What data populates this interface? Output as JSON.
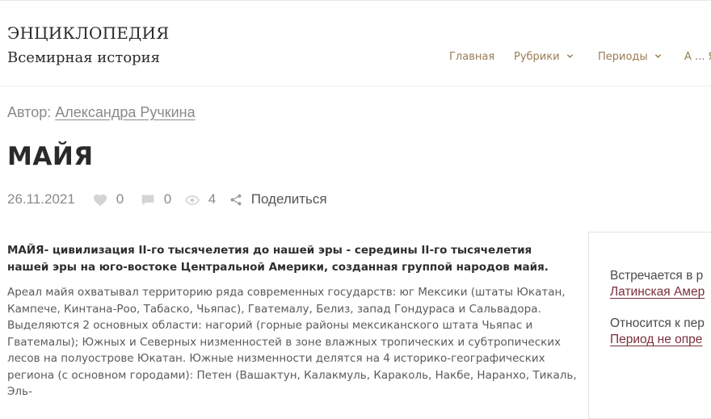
{
  "header": {
    "site_name": "ЭНЦИКЛОПЕДИЯ",
    "site_description": "Всемирная история",
    "nav": [
      {
        "label": "Главная",
        "has_dropdown": false
      },
      {
        "label": "Рубрики",
        "has_dropdown": true
      },
      {
        "label": "Периоды",
        "has_dropdown": true
      },
      {
        "label": "А ... Я",
        "has_dropdown": false
      }
    ]
  },
  "author": {
    "prefix": "Автор:",
    "name": "Александра Ручкина"
  },
  "page_title": "МАЙЯ",
  "meta": {
    "date": "26.11.2021",
    "likes": "0",
    "comments": "0",
    "views": "4",
    "share_label": "Поделиться"
  },
  "article": {
    "lead": "МАЙЯ- цивилизация II-го тысячелетия до нашей эры - середины II-го тысячелетия нашей эры на юго-востоке Центральной Америки, созданная группой народов майя.",
    "body": "Ареал майя охватывал территорию ряда современных государств: юг Мексики (штаты Юкатан, Кампече, Кинтана-Роо, Табаско, Чьяпас), Гватемалу, Белиз, запад Гондураса и Сальвадора. Выделяются 2 основных области: нагорий (горные районы мексиканского штата Чьяпас и Гватемалы); Южных и Северных низменностей в зоне влажных тропических и субтропических лесов на полуострове Юкатан. Южные низменности делятся на 4 историко-географических региона (с основном городами): Петен (Вашактун, Калакмуль, Караколь, Накбе, Наранхо, Тикаль, Эль-"
  },
  "sidebar": {
    "found_in_label": "Встречается в р",
    "found_in_link": "Латинская Амер",
    "belongs_label": "Относится к пер",
    "belongs_link": "Период не опре"
  },
  "colors": {
    "nav": "#9a7c54",
    "sidebar_link": "#7a2f3a",
    "meta_gray": "#8a8a8a",
    "title": "#2a2a2a"
  },
  "icons": {
    "likes": "heart-icon",
    "comments": "comment-icon",
    "views": "eye-icon",
    "share": "share-icon",
    "dropdown": "chevron-down-icon"
  }
}
